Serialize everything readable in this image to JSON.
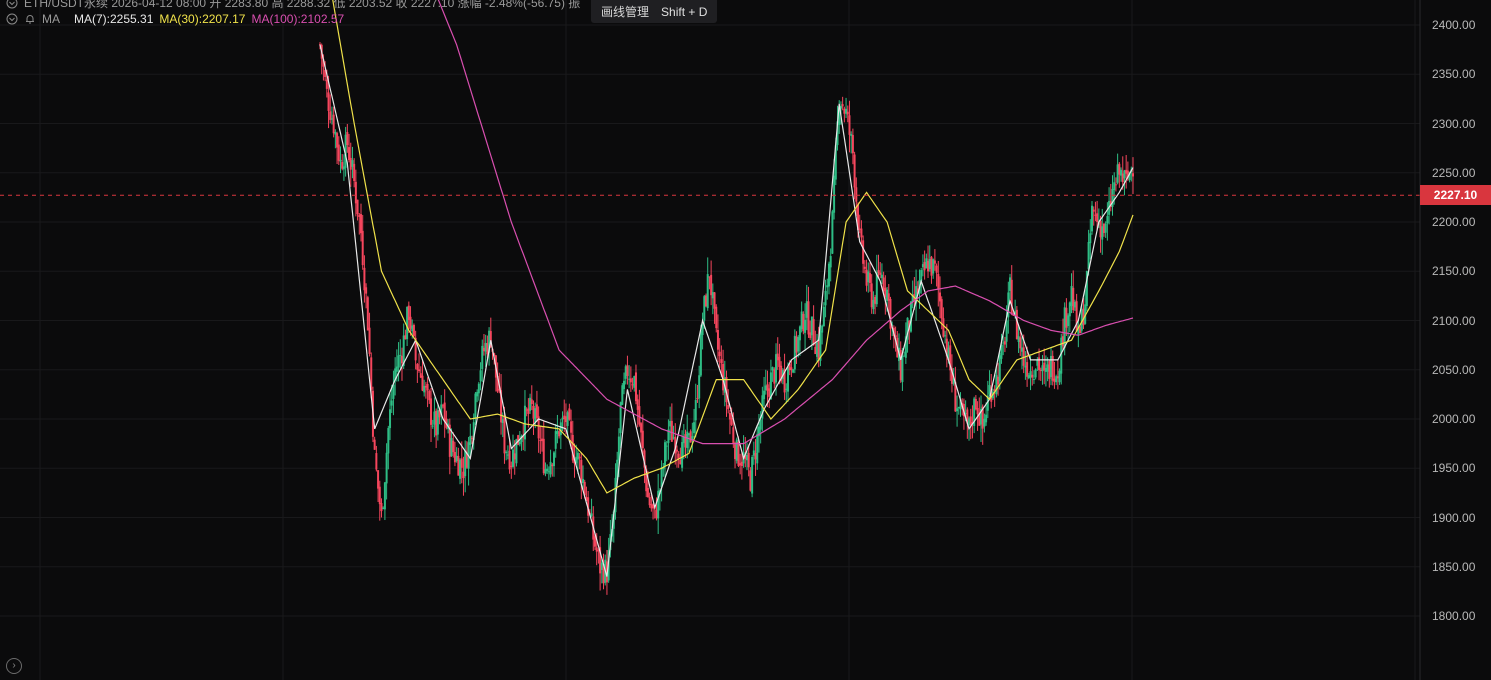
{
  "header": {
    "symbol_line": "ETH/USDT永续 2026-04-12 08:00 开 2283.80 高 2288.32 低 2203.52 收 2227.10 涨幅 -2.48%(-56.75) 振",
    "indicator_name": "MA",
    "ma7_label": "MA(7):2255.31",
    "ma30_label": "MA(30):2207.17",
    "ma100_label": "MA(100):2102.57"
  },
  "tooltip": {
    "title": "画线管理",
    "shortcut": "Shift + D"
  },
  "current_price_label": "2227.10",
  "colors": {
    "bull": "#2ebd85",
    "bear": "#f6465d",
    "ma7": "#e8e8e8",
    "ma30": "#f0e24a",
    "ma100": "#d94fb0",
    "price_tag": "#d9363e"
  },
  "icons": [
    "bell-icon",
    "chevron-right-circle-icon"
  ],
  "chart_data": {
    "type": "candlestick",
    "title": "ETH/USDT永续",
    "ylim": [
      1750,
      2425
    ],
    "y_ticks": [
      "2400.00",
      "2350.00",
      "2300.00",
      "2250.00",
      "2200.00",
      "2150.00",
      "2100.00",
      "2050.00",
      "2000.00",
      "1950.00",
      "1900.00",
      "1850.00",
      "1800.00"
    ],
    "last_price": 2227.1,
    "grid": true,
    "close_path": [
      [
        0,
        2380
      ],
      [
        2,
        2330
      ],
      [
        4,
        2300
      ],
      [
        6,
        2260
      ],
      [
        8,
        2280
      ],
      [
        10,
        2240
      ],
      [
        12,
        2190
      ],
      [
        14,
        2100
      ],
      [
        16,
        1960
      ],
      [
        18,
        1900
      ],
      [
        20,
        1990
      ],
      [
        22,
        2050
      ],
      [
        24,
        2070
      ],
      [
        26,
        2110
      ],
      [
        28,
        2060
      ],
      [
        30,
        2040
      ],
      [
        32,
        2010
      ],
      [
        34,
        1990
      ],
      [
        36,
        2010
      ],
      [
        38,
        1975
      ],
      [
        40,
        1960
      ],
      [
        42,
        1950
      ],
      [
        44,
        1980
      ],
      [
        46,
        2040
      ],
      [
        48,
        2070
      ],
      [
        50,
        2085
      ],
      [
        52,
        2030
      ],
      [
        54,
        1975
      ],
      [
        56,
        1960
      ],
      [
        58,
        1980
      ],
      [
        60,
        2000
      ],
      [
        62,
        2010
      ],
      [
        64,
        1985
      ],
      [
        66,
        1950
      ],
      [
        68,
        1965
      ],
      [
        70,
        1990
      ],
      [
        72,
        2000
      ],
      [
        74,
        1970
      ],
      [
        76,
        1955
      ],
      [
        78,
        1920
      ],
      [
        80,
        1880
      ],
      [
        82,
        1850
      ],
      [
        84,
        1845
      ],
      [
        86,
        1900
      ],
      [
        88,
        2010
      ],
      [
        90,
        2050
      ],
      [
        92,
        2040
      ],
      [
        94,
        1980
      ],
      [
        96,
        1920
      ],
      [
        98,
        1900
      ],
      [
        100,
        1940
      ],
      [
        102,
        1990
      ],
      [
        104,
        1980
      ],
      [
        106,
        1965
      ],
      [
        108,
        1975
      ],
      [
        110,
        2010
      ],
      [
        112,
        2100
      ],
      [
        114,
        2150
      ],
      [
        116,
        2080
      ],
      [
        118,
        2040
      ],
      [
        120,
        2000
      ],
      [
        122,
        1965
      ],
      [
        124,
        1960
      ],
      [
        126,
        1940
      ],
      [
        128,
        1980
      ],
      [
        130,
        2020
      ],
      [
        132,
        2040
      ],
      [
        134,
        2055
      ],
      [
        136,
        2040
      ],
      [
        138,
        2060
      ],
      [
        140,
        2080
      ],
      [
        142,
        2110
      ],
      [
        144,
        2090
      ],
      [
        146,
        2070
      ],
      [
        148,
        2120
      ],
      [
        150,
        2200
      ],
      [
        152,
        2330
      ],
      [
        154,
        2310
      ],
      [
        156,
        2270
      ],
      [
        158,
        2180
      ],
      [
        160,
        2140
      ],
      [
        162,
        2120
      ],
      [
        164,
        2150
      ],
      [
        166,
        2130
      ],
      [
        168,
        2080
      ],
      [
        170,
        2050
      ],
      [
        172,
        2090
      ],
      [
        174,
        2120
      ],
      [
        176,
        2140
      ],
      [
        178,
        2160
      ],
      [
        180,
        2150
      ],
      [
        182,
        2110
      ],
      [
        184,
        2060
      ],
      [
        186,
        2020
      ],
      [
        188,
        2000
      ],
      [
        190,
        1990
      ],
      [
        192,
        2020
      ],
      [
        194,
        1990
      ],
      [
        196,
        2030
      ],
      [
        198,
        2040
      ],
      [
        200,
        2070
      ],
      [
        202,
        2130
      ],
      [
        204,
        2090
      ],
      [
        206,
        2060
      ],
      [
        208,
        2050
      ],
      [
        210,
        2060
      ],
      [
        212,
        2040
      ],
      [
        214,
        2055
      ],
      [
        216,
        2050
      ],
      [
        218,
        2100
      ],
      [
        220,
        2130
      ],
      [
        222,
        2080
      ],
      [
        224,
        2120
      ],
      [
        226,
        2210
      ],
      [
        228,
        2200
      ],
      [
        230,
        2190
      ],
      [
        232,
        2230
      ],
      [
        234,
        2250
      ],
      [
        236,
        2240
      ],
      [
        238,
        2260
      ]
    ],
    "series": [
      {
        "name": "MA(7)",
        "values": [
          [
            0,
            2380
          ],
          [
            8,
            2260
          ],
          [
            16,
            1990
          ],
          [
            22,
            2040
          ],
          [
            28,
            2080
          ],
          [
            36,
            2000
          ],
          [
            44,
            1960
          ],
          [
            50,
            2080
          ],
          [
            56,
            1970
          ],
          [
            64,
            2000
          ],
          [
            72,
            1990
          ],
          [
            80,
            1890
          ],
          [
            84,
            1840
          ],
          [
            90,
            2030
          ],
          [
            98,
            1910
          ],
          [
            104,
            1970
          ],
          [
            112,
            2100
          ],
          [
            118,
            2040
          ],
          [
            124,
            1960
          ],
          [
            130,
            2010
          ],
          [
            138,
            2060
          ],
          [
            146,
            2080
          ],
          [
            152,
            2320
          ],
          [
            158,
            2180
          ],
          [
            164,
            2140
          ],
          [
            170,
            2060
          ],
          [
            176,
            2140
          ],
          [
            184,
            2060
          ],
          [
            190,
            1990
          ],
          [
            196,
            2020
          ],
          [
            202,
            2120
          ],
          [
            208,
            2060
          ],
          [
            216,
            2060
          ],
          [
            222,
            2100
          ],
          [
            228,
            2200
          ],
          [
            234,
            2230
          ],
          [
            238,
            2255.31
          ]
        ]
      },
      {
        "name": "MA(30)",
        "values": [
          [
            0,
            2500
          ],
          [
            10,
            2300
          ],
          [
            18,
            2150
          ],
          [
            26,
            2090
          ],
          [
            34,
            2050
          ],
          [
            44,
            2000
          ],
          [
            52,
            2005
          ],
          [
            60,
            1995
          ],
          [
            70,
            1990
          ],
          [
            78,
            1960
          ],
          [
            84,
            1925
          ],
          [
            92,
            1940
          ],
          [
            100,
            1950
          ],
          [
            108,
            1965
          ],
          [
            116,
            2040
          ],
          [
            124,
            2040
          ],
          [
            132,
            2000
          ],
          [
            140,
            2030
          ],
          [
            148,
            2070
          ],
          [
            154,
            2200
          ],
          [
            160,
            2230
          ],
          [
            166,
            2200
          ],
          [
            172,
            2130
          ],
          [
            178,
            2110
          ],
          [
            184,
            2090
          ],
          [
            190,
            2040
          ],
          [
            196,
            2020
          ],
          [
            204,
            2060
          ],
          [
            212,
            2070
          ],
          [
            220,
            2080
          ],
          [
            228,
            2130
          ],
          [
            234,
            2170
          ],
          [
            238,
            2207.17
          ]
        ]
      },
      {
        "name": "MA(100)",
        "values": [
          [
            0,
            2700
          ],
          [
            20,
            2550
          ],
          [
            40,
            2380
          ],
          [
            56,
            2200
          ],
          [
            70,
            2070
          ],
          [
            84,
            2020
          ],
          [
            100,
            1990
          ],
          [
            112,
            1975
          ],
          [
            124,
            1975
          ],
          [
            136,
            2000
          ],
          [
            150,
            2040
          ],
          [
            160,
            2080
          ],
          [
            170,
            2110
          ],
          [
            178,
            2130
          ],
          [
            186,
            2135
          ],
          [
            196,
            2120
          ],
          [
            206,
            2100
          ],
          [
            214,
            2090
          ],
          [
            222,
            2085
          ],
          [
            230,
            2095
          ],
          [
            238,
            2102.57
          ]
        ]
      }
    ]
  }
}
